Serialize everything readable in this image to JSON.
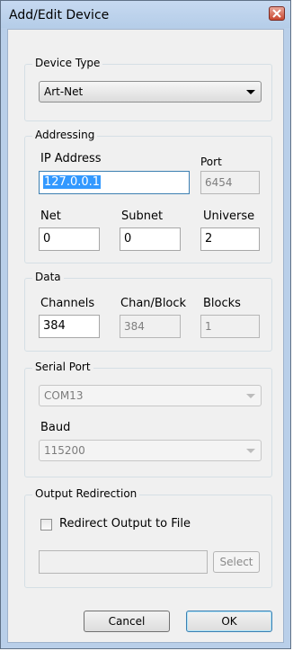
{
  "window": {
    "title": "Add/Edit Device"
  },
  "device_type": {
    "group_label": "Device Type",
    "selected": "Art-Net"
  },
  "addressing": {
    "group_label": "Addressing",
    "ip_label": "IP Address",
    "ip_value": "127.0.0.1",
    "port_label": "Port",
    "port_value": "6454",
    "net_label": "Net",
    "net_value": "0",
    "subnet_label": "Subnet",
    "subnet_value": "0",
    "universe_label": "Universe",
    "universe_value": "2"
  },
  "data": {
    "group_label": "Data",
    "channels_label": "Channels",
    "channels_value": "384",
    "chan_block_label": "Chan/Block",
    "chan_block_value": "384",
    "blocks_label": "Blocks",
    "blocks_value": "1"
  },
  "serial": {
    "group_label": "Serial Port",
    "port_selected": "COM13",
    "baud_label": "Baud",
    "baud_selected": "115200"
  },
  "output": {
    "group_label": "Output Redirection",
    "redirect_label": "Redirect Output to File",
    "redirect_checked": false,
    "file_path": "",
    "select_label": "Select"
  },
  "buttons": {
    "cancel": "Cancel",
    "ok": "OK"
  },
  "colors": {
    "title_bar": "#b9cfe9",
    "client_bg": "#f0f0f0",
    "selection": "#3399ff",
    "close_button": "#c9472f"
  }
}
